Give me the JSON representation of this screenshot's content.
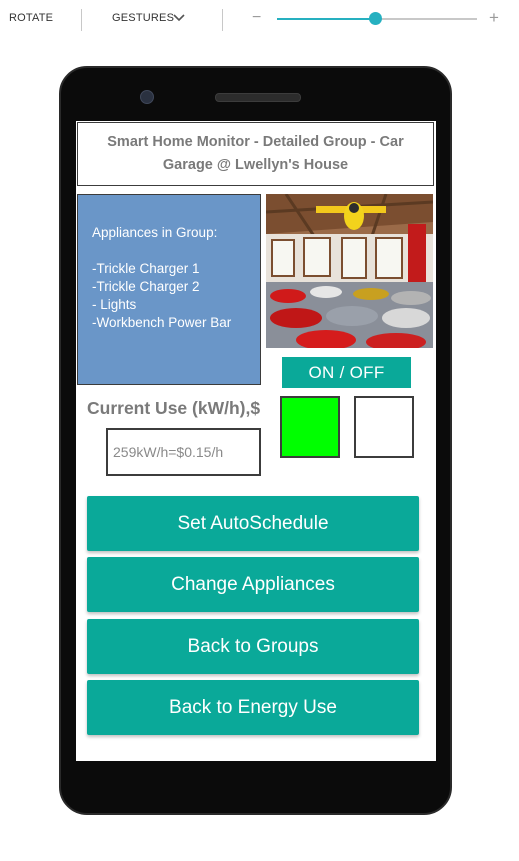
{
  "toolbar": {
    "rotate_label": "ROTATE",
    "gestures_label": "GESTURES",
    "zoom_minus": "−",
    "zoom_plus": "+",
    "zoom_level": 0.49,
    "accent": "#26b0c0"
  },
  "screen": {
    "title": "Smart Home Monitor - Detailed Group - Car Garage @ Lwellyn's House",
    "appliances": {
      "heading": "Appliances in Group:",
      "items": [
        "-Trickle Charger 1",
        "-Trickle Charger 2",
        "- Lights",
        "-Workbench Power Bar"
      ],
      "bg_color": "#6a96c8"
    },
    "photo": {
      "description_icon": "garage-photo"
    },
    "onoff_label": "ON / OFF",
    "indicators": {
      "green_color": "#00ff00",
      "white_color": "#ffffff"
    },
    "current_use": {
      "label": "Current Use (kW/h),$",
      "placeholder": "259kW/h=$0.15/h"
    },
    "buttons": {
      "autoschedule": "Set AutoSchedule",
      "change_appliances": "Change Appliances",
      "back_groups": "Back to Groups",
      "back_energy": "Back to Energy Use"
    },
    "button_color": "#0aa999"
  }
}
